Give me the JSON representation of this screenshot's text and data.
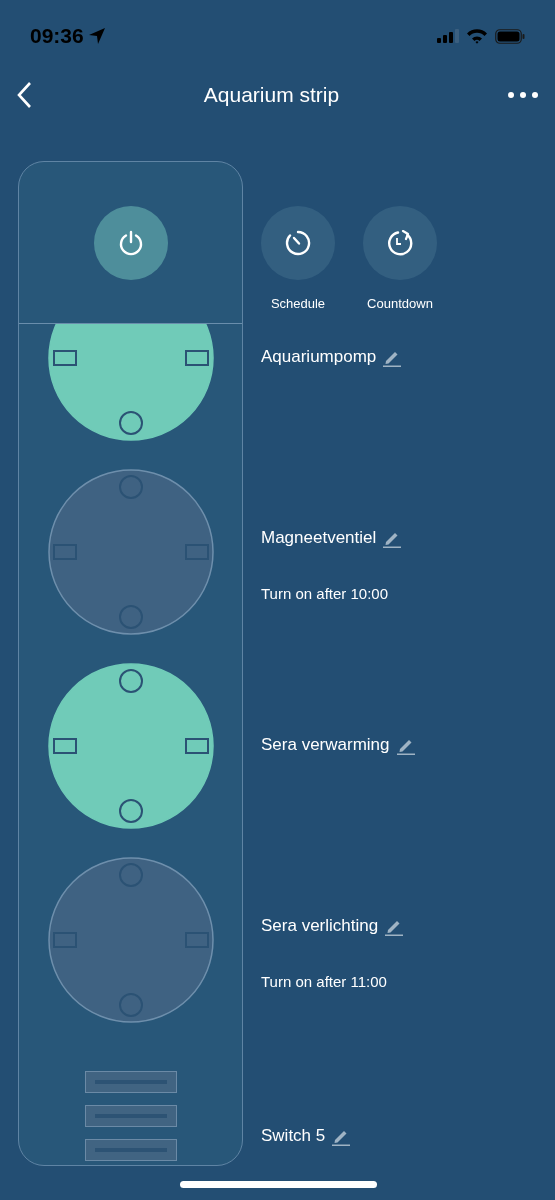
{
  "status_bar": {
    "time": "09:36"
  },
  "header": {
    "title": "Aquarium strip"
  },
  "master": {
    "on": true
  },
  "actions": [
    {
      "kind": "schedule",
      "label": "Schedule"
    },
    {
      "kind": "countdown",
      "label": "Countdown"
    }
  ],
  "outlets": [
    {
      "kind": "socket",
      "name": "Aquariumpomp",
      "on": true
    },
    {
      "kind": "socket",
      "name": "Magneetventiel",
      "on": false,
      "timer": "Turn on after 10:00"
    },
    {
      "kind": "socket",
      "name": "Sera verwarming",
      "on": true
    },
    {
      "kind": "socket",
      "name": "Sera verlichting",
      "on": false,
      "timer": "Turn on after 11:00"
    },
    {
      "kind": "usb",
      "name": "Switch 5"
    }
  ]
}
